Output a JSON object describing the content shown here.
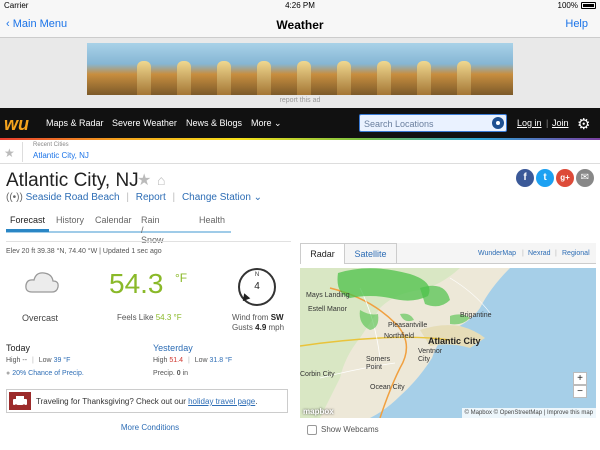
{
  "status_bar": {
    "carrier": "Carrier",
    "time": "4:26 PM",
    "battery": "100%"
  },
  "nav_bar": {
    "back_label": "Main Menu",
    "title": "Weather",
    "help_label": "Help"
  },
  "ad": {
    "report_label": "report this ad"
  },
  "header": {
    "logo": "wu",
    "nav": [
      "Maps & Radar",
      "Severe Weather",
      "News & Blogs",
      "More"
    ],
    "search_placeholder": "Search Locations",
    "login_label": "Log in",
    "join_label": "Join"
  },
  "recent": {
    "label": "Recent Cities",
    "city": "Atlantic City, NJ"
  },
  "location": {
    "title": "Atlantic City, NJ",
    "station": "Seaside Road Beach",
    "report_label": "Report",
    "change_station_label": "Change Station"
  },
  "social": {
    "facebook": "f",
    "twitter": "t",
    "gplus": "g+",
    "email": "✉",
    "colors": {
      "facebook": "#3b5998",
      "twitter": "#1da1f2",
      "gplus": "#dd4b39",
      "email": "#888888"
    }
  },
  "tabs": [
    "Forecast",
    "History",
    "Calendar",
    "Rain / Snow",
    "Health"
  ],
  "conditions": {
    "elev_line": "Elev 20 ft 39.38 °N, 74.40 °W  |  Updated 1 sec ago",
    "condition": "Overcast",
    "temp": "54.3",
    "temp_unit": "°F",
    "feels_like_label": "Feels Like",
    "feels_like_value": "54.3 °F",
    "wind_dir_letter": "N",
    "wind_speed": "4",
    "wind_from_label": "Wind from",
    "wind_from": "SW",
    "gusts_label": "Gusts",
    "gusts_value": "4.9",
    "gusts_unit": "mph"
  },
  "today": {
    "heading": "Today",
    "high_label": "High",
    "high_value": "--",
    "low_label": "Low",
    "low_value": "39 °F",
    "precip_pct": "20%",
    "precip_label": "Chance of Precip."
  },
  "yesterday": {
    "heading": "Yesterday",
    "high_label": "High",
    "high_value": "51.4",
    "low_label": "Low",
    "low_value": "31.8 °F",
    "precip_label": "Precip.",
    "precip_value": "0",
    "precip_unit": "in"
  },
  "travel": {
    "text": "Traveling for Thanksgiving? Check out our",
    "link": "holiday travel page",
    "suffix": "."
  },
  "more_conditions_label": "More Conditions",
  "map": {
    "tabs": [
      "Radar",
      "Satellite"
    ],
    "links": [
      "WunderMap",
      "Nexrad",
      "Regional"
    ],
    "labels": [
      "Estell Manor",
      "Pleasantville",
      "Northfield",
      "Brigantine",
      "Atlantic City",
      "Ventnor City",
      "Somers Point",
      "Ocean City",
      "Corbin City",
      "Mays Landing"
    ],
    "zoom_in": "+",
    "zoom_out": "−",
    "logo": "mapbox",
    "attribution": "© Mapbox © OpenStreetMap | Improve this map"
  },
  "webcams_label": "Show Webcams"
}
